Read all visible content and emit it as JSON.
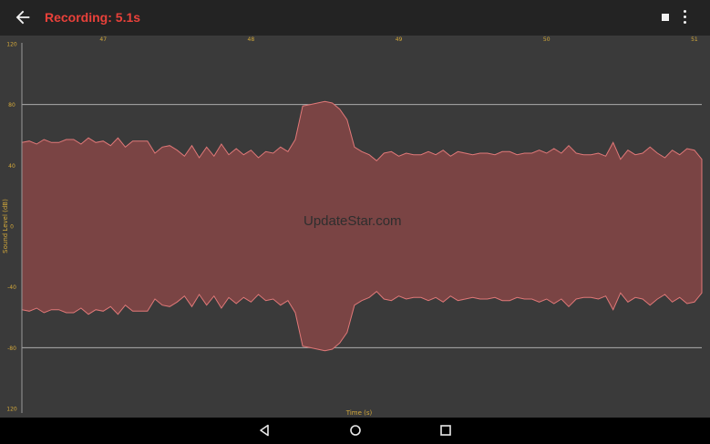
{
  "app": {
    "title": "Recording: 5.1s"
  },
  "toolbar": {
    "back_icon": "arrow-left-icon",
    "stop_icon": "stop-icon",
    "more_icon": "more-vert-icon"
  },
  "watermark": "UpdateStar.com",
  "colors": {
    "accent": "#e9413a",
    "fill": "#7a4444",
    "stroke": "#e07878",
    "tick": "#d4a93a",
    "bg": "#3a3a3a",
    "grid": "#cfcfcf"
  },
  "chart_data": {
    "type": "area",
    "xlabel": "Time (s)",
    "ylabel": "Sound Level (dB)",
    "xlim": [
      46.45,
      51.05
    ],
    "ylim": [
      -120,
      120
    ],
    "x_ticks": [
      "47",
      "48",
      "49",
      "50",
      "51"
    ],
    "y_ticks": [
      "120",
      "80",
      "40",
      "0",
      "-40",
      "-80",
      "120"
    ],
    "grid": true,
    "series": [
      {
        "values": [
          [
            46.45,
            55
          ],
          [
            46.5,
            56
          ],
          [
            46.55,
            54
          ],
          [
            46.6,
            57
          ],
          [
            46.65,
            55
          ],
          [
            46.7,
            55
          ],
          [
            46.75,
            57
          ],
          [
            46.8,
            57
          ],
          [
            46.85,
            54
          ],
          [
            46.9,
            58
          ],
          [
            46.95,
            55
          ],
          [
            47.0,
            56
          ],
          [
            47.05,
            53
          ],
          [
            47.1,
            58
          ],
          [
            47.15,
            52
          ],
          [
            47.2,
            56
          ],
          [
            47.25,
            56
          ],
          [
            47.3,
            56
          ],
          [
            47.35,
            48
          ],
          [
            47.4,
            52
          ],
          [
            47.45,
            53
          ],
          [
            47.5,
            50
          ],
          [
            47.55,
            46
          ],
          [
            47.6,
            53
          ],
          [
            47.65,
            45
          ],
          [
            47.7,
            52
          ],
          [
            47.75,
            46
          ],
          [
            47.8,
            54
          ],
          [
            47.85,
            47
          ],
          [
            47.9,
            51
          ],
          [
            47.95,
            47
          ],
          [
            48.0,
            50
          ],
          [
            48.05,
            45
          ],
          [
            48.1,
            49
          ],
          [
            48.15,
            48
          ],
          [
            48.2,
            52
          ],
          [
            48.25,
            49
          ],
          [
            48.3,
            57
          ],
          [
            48.35,
            79
          ],
          [
            48.4,
            80
          ],
          [
            48.45,
            81
          ],
          [
            48.5,
            82
          ],
          [
            48.55,
            81
          ],
          [
            48.6,
            77
          ],
          [
            48.65,
            70
          ],
          [
            48.7,
            52
          ],
          [
            48.75,
            49
          ],
          [
            48.8,
            47
          ],
          [
            48.85,
            43
          ],
          [
            48.9,
            48
          ],
          [
            48.95,
            49
          ],
          [
            49.0,
            46
          ],
          [
            49.05,
            48
          ],
          [
            49.1,
            47
          ],
          [
            49.15,
            47
          ],
          [
            49.2,
            49
          ],
          [
            49.25,
            47
          ],
          [
            49.3,
            50
          ],
          [
            49.35,
            46
          ],
          [
            49.4,
            49
          ],
          [
            49.45,
            48
          ],
          [
            49.5,
            47
          ],
          [
            49.55,
            48
          ],
          [
            49.6,
            48
          ],
          [
            49.65,
            47
          ],
          [
            49.7,
            49
          ],
          [
            49.75,
            49
          ],
          [
            49.8,
            47
          ],
          [
            49.85,
            48
          ],
          [
            49.9,
            48
          ],
          [
            49.95,
            50
          ],
          [
            50.0,
            48
          ],
          [
            50.05,
            51
          ],
          [
            50.1,
            48
          ],
          [
            50.15,
            53
          ],
          [
            50.2,
            48
          ],
          [
            50.25,
            47
          ],
          [
            50.3,
            47
          ],
          [
            50.35,
            48
          ],
          [
            50.4,
            46
          ],
          [
            50.45,
            55
          ],
          [
            50.5,
            44
          ],
          [
            50.55,
            50
          ],
          [
            50.6,
            47
          ],
          [
            50.65,
            48
          ],
          [
            50.7,
            52
          ],
          [
            50.75,
            48
          ],
          [
            50.8,
            45
          ],
          [
            50.85,
            50
          ],
          [
            50.9,
            47
          ],
          [
            50.95,
            51
          ],
          [
            51.0,
            50
          ],
          [
            51.05,
            44
          ]
        ]
      }
    ]
  },
  "nav": {
    "back_icon": "nav-back-icon",
    "home_icon": "nav-home-icon",
    "recents_icon": "nav-recents-icon"
  }
}
